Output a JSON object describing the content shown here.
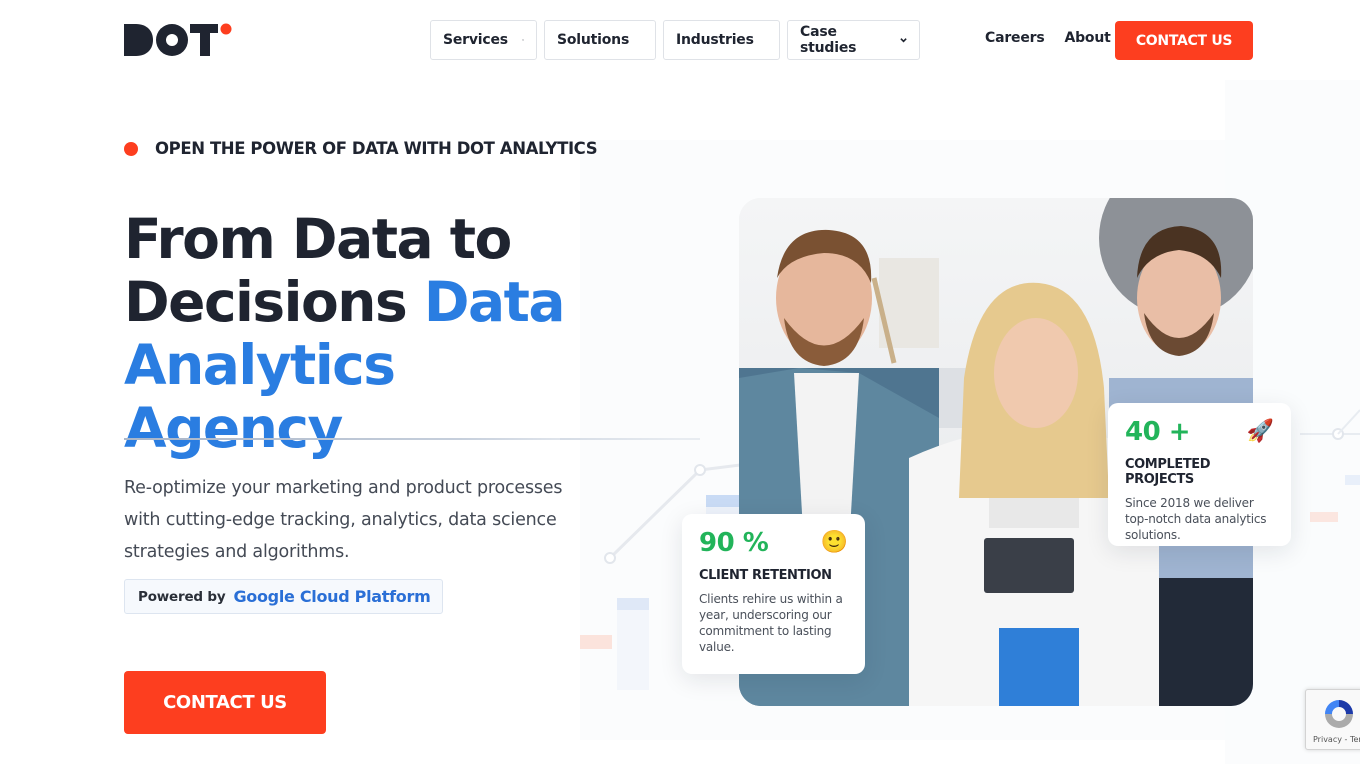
{
  "brand": {
    "name": "DOT",
    "accent_color": "#fd3e1f",
    "heading_color": "#1f2430",
    "link_blue": "#2a7de1",
    "stat_green": "#22b45a"
  },
  "header": {
    "nav_dropdowns": [
      {
        "label": "Services",
        "icon": "chevron-down-icon"
      },
      {
        "label": "Solutions",
        "icon": "chevron-down-icon"
      },
      {
        "label": "Industries",
        "icon": "chevron-down-icon"
      },
      {
        "label": "Case studies",
        "icon": "chevron-down-icon"
      }
    ],
    "nav_links": [
      {
        "label": "Careers"
      },
      {
        "label": "About"
      }
    ],
    "cta_label": "CONTACT US"
  },
  "hero": {
    "eyebrow": "OPEN THE POWER OF DATA WITH DOT ANALYTICS",
    "headline_part1": "From Data to Decisions ",
    "headline_accent": "Data Analytics Agency",
    "lead": "Re-optimize your marketing and product processes with cutting-edge tracking, analytics, data science strategies and algorithms.",
    "powered_by_prefix": "Powered by",
    "powered_by_name": "Google Cloud Platform",
    "cta_label": "CONTACT US",
    "photo_alt": "Team of three smiling data analysts"
  },
  "stats": [
    {
      "value": "90 %",
      "emoji": "🙂",
      "emoji_name": "smiling-face-icon",
      "title": "CLIENT RETENTION",
      "description": "Clients rehire us within a year, underscoring our commitment to lasting value."
    },
    {
      "value": "40 +",
      "emoji": "🚀",
      "emoji_name": "rocket-icon",
      "title": "COMPLETED PROJECTS",
      "description": "Since 2018 we deliver top-notch data analytics solutions."
    }
  ],
  "recaptcha": {
    "label": "Privacy - Terms"
  }
}
